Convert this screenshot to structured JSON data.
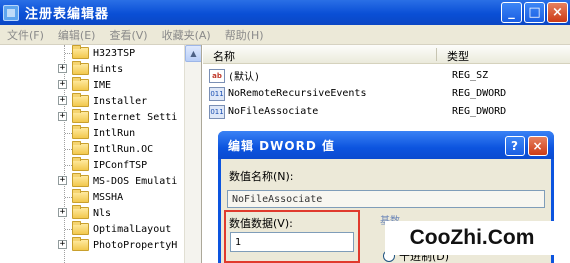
{
  "window": {
    "title": "注册表编辑器",
    "buttons": {
      "minimize": "_",
      "maximize": "□",
      "close": "×"
    }
  },
  "menu": [
    "文件(F)",
    "编辑(E)",
    "查看(V)",
    "收藏夹(A)",
    "帮助(H)"
  ],
  "tree": {
    "items": [
      {
        "label": "H323TSP",
        "expanded": false,
        "has_children": false
      },
      {
        "label": "Hints",
        "has_children": true
      },
      {
        "label": "IME",
        "has_children": true
      },
      {
        "label": "Installer",
        "has_children": true
      },
      {
        "label": "Internet Setti",
        "has_children": true
      },
      {
        "label": "IntlRun",
        "has_children": false
      },
      {
        "label": "IntlRun.OC",
        "has_children": false
      },
      {
        "label": "IPConfTSP",
        "has_children": false
      },
      {
        "label": "MS-DOS Emulati",
        "has_children": true
      },
      {
        "label": "MSSHA",
        "has_children": false
      },
      {
        "label": "Nls",
        "has_children": true
      },
      {
        "label": "OptimalLayout",
        "has_children": false
      },
      {
        "label": "PhotoPropertyH",
        "has_children": true
      }
    ],
    "expander_symbol": "+"
  },
  "list": {
    "headers": {
      "name": "名称",
      "type": "类型"
    },
    "rows": [
      {
        "icon": "string-value-icon",
        "icon_text": "ab",
        "name": "(默认)",
        "type": "REG_SZ"
      },
      {
        "icon": "dword-value-icon",
        "icon_text": "011",
        "name": "NoRemoteRecursiveEvents",
        "type": "REG_DWORD"
      },
      {
        "icon": "dword-value-icon",
        "icon_text": "011",
        "name": "NoFileAssociate",
        "type": "REG_DWORD"
      }
    ]
  },
  "dialog": {
    "title": "编辑 DWORD 值",
    "help_button": "?",
    "close_button": "×",
    "value_name_label": "数值名称(N):",
    "value_name": "NoFileAssociate",
    "value_data_label": "数值数据(V):",
    "value_data": "1",
    "base_label": "基数",
    "radio_decimal": "十进制(D)"
  },
  "watermark": "CooZhi.Com",
  "colors": {
    "titlebar": "#0a4fd6",
    "dialog_frame": "#0c54df",
    "highlight_box": "#e03a2d",
    "menubar": "#ece9d8"
  }
}
